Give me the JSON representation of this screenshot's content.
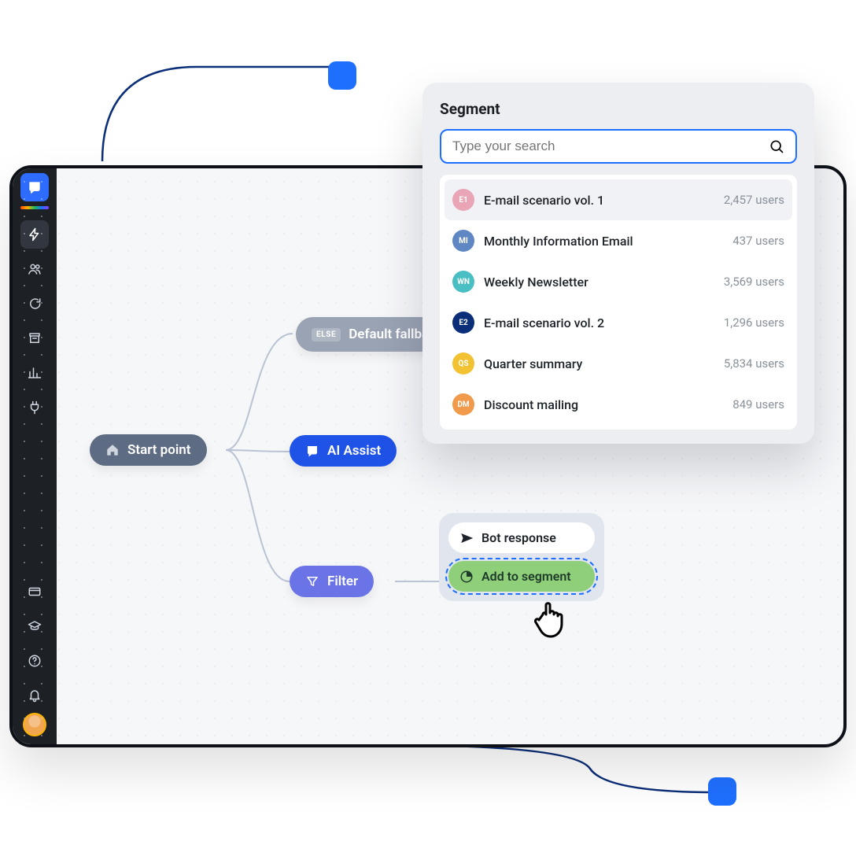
{
  "canvas": {
    "start_label": "Start point",
    "fallback_tag": "ELSE",
    "fallback_label": "Default fallback",
    "ai_label": "AI Assist",
    "filter_label": "Filter",
    "bot_response_label": "Bot response",
    "add_to_segment_label": "Add to segment"
  },
  "segment_panel": {
    "title": "Segment",
    "search_placeholder": "Type your search",
    "rows": [
      {
        "badge": "E1",
        "color": "#e9a4b6",
        "name": "E-mail scenario vol. 1",
        "count": "2,457 users"
      },
      {
        "badge": "MI",
        "color": "#5f87c3",
        "name": "Monthly Information Email",
        "count": "437 users"
      },
      {
        "badge": "WN",
        "color": "#49bfc4",
        "name": "Weekly Newsletter",
        "count": "3,569 users"
      },
      {
        "badge": "E2",
        "color": "#0b2e78",
        "name": "E-mail scenario vol. 2",
        "count": "1,296 users"
      },
      {
        "badge": "QS",
        "color": "#f2c233",
        "name": "Quarter summary",
        "count": "5,834 users"
      },
      {
        "badge": "DM",
        "color": "#f19a4c",
        "name": "Discount mailing",
        "count": "849 users"
      }
    ]
  },
  "sidebar": {
    "icons": [
      "bolt",
      "users",
      "chat",
      "archive",
      "chart",
      "plug"
    ],
    "footer_icons": [
      "card",
      "grad",
      "help",
      "bell"
    ]
  }
}
